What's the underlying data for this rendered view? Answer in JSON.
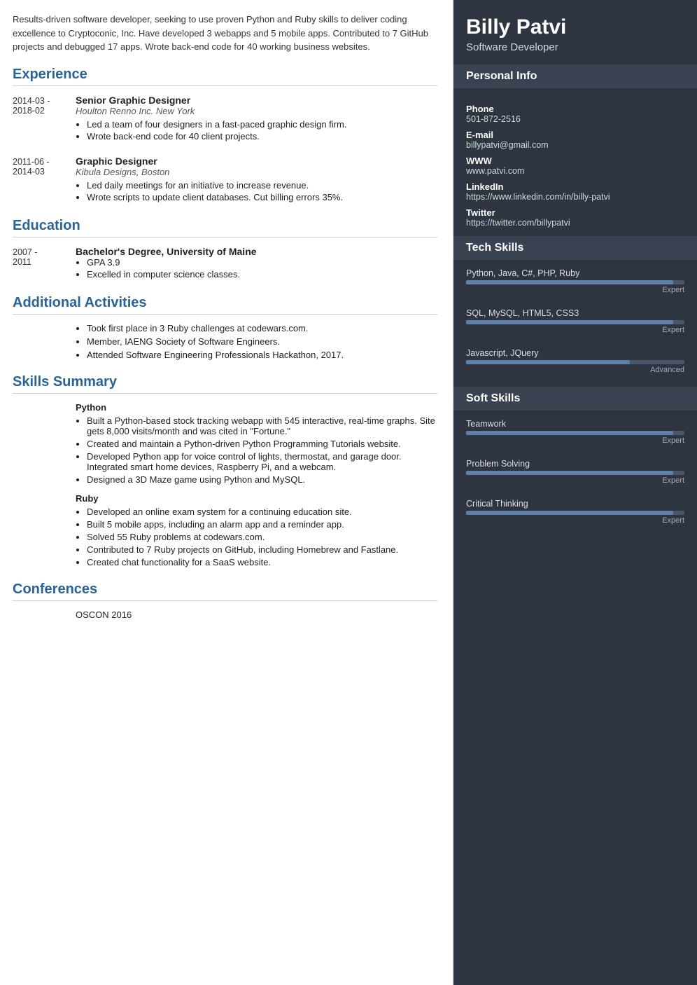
{
  "summary": "Results-driven software developer, seeking to use proven Python and Ruby skills to deliver coding excellence to Cryptoconic, Inc. Have developed 3 webapps and 5 mobile apps. Contributed to 7 GitHub projects and debugged 17 apps. Wrote back-end code for 40 working business websites.",
  "sections": {
    "experience": {
      "title": "Experience",
      "entries": [
        {
          "date_start": "2014-03 -",
          "date_end": "2018-02",
          "job_title": "Senior Graphic Designer",
          "company": "Houlton Renno Inc. New York",
          "bullets": [
            "Led a team of four designers in a fast-paced graphic design firm.",
            "Wrote back-end code for 40 client projects."
          ]
        },
        {
          "date_start": "2011-06 -",
          "date_end": "2014-03",
          "job_title": "Graphic Designer",
          "company": "Kibula Designs, Boston",
          "bullets": [
            "Led daily meetings for an initiative to increase revenue.",
            "Wrote scripts to update client databases. Cut billing errors 35%."
          ]
        }
      ]
    },
    "education": {
      "title": "Education",
      "entries": [
        {
          "date_start": "2007 -",
          "date_end": "2011",
          "degree": "Bachelor's Degree, University of Maine",
          "bullets": [
            "GPA 3.9",
            "Excelled in computer science classes."
          ]
        }
      ]
    },
    "additional_activities": {
      "title": "Additional Activities",
      "bullets": [
        "Took first place in 3 Ruby challenges at codewars.com.",
        "Member, IAENG Society of Software Engineers.",
        "Attended Software Engineering Professionals Hackathon, 2017."
      ]
    },
    "skills_summary": {
      "title": "Skills Summary",
      "subsections": [
        {
          "name": "Python",
          "bullets": [
            "Built a Python-based stock tracking webapp with 545 interactive, real-time graphs. Site gets 8,000 visits/month and was cited in \"Fortune.\"",
            "Created and maintain a Python-driven Python Programming Tutorials website.",
            "Developed Python app for voice control of lights, thermostat, and garage door. Integrated smart home devices, Raspberry Pi, and a webcam.",
            "Designed a 3D Maze game using Python and MySQL."
          ]
        },
        {
          "name": "Ruby",
          "bullets": [
            "Developed an online exam system for a continuing education site.",
            "Built 5 mobile apps, including an alarm app and a reminder app.",
            "Solved 55 Ruby problems at codewars.com.",
            "Contributed to 7 Ruby projects on GitHub, including Homebrew and Fastlane.",
            "Created chat functionality for a SaaS website."
          ]
        }
      ]
    },
    "conferences": {
      "title": "Conferences",
      "items": [
        "OSCON 2016"
      ]
    }
  },
  "right": {
    "name": "Billy Patvi",
    "title": "Software Developer",
    "personal_info": {
      "section_title": "Personal Info",
      "fields": [
        {
          "label": "Phone",
          "value": "501-872-2516"
        },
        {
          "label": "E-mail",
          "value": "billypatvi@gmail.com"
        },
        {
          "label": "WWW",
          "value": "www.patvi.com"
        },
        {
          "label": "LinkedIn",
          "value": "https://www.linkedin.com/in/billy-patvi"
        },
        {
          "label": "Twitter",
          "value": "https://twitter.com/billypatvi"
        }
      ]
    },
    "tech_skills": {
      "section_title": "Tech Skills",
      "skills": [
        {
          "name": "Python, Java, C#, PHP, Ruby",
          "level": "Expert",
          "pct": 95
        },
        {
          "name": "SQL, MySQL, HTML5, CSS3",
          "level": "Expert",
          "pct": 95
        },
        {
          "name": "Javascript, JQuery",
          "level": "Advanced",
          "pct": 75
        }
      ]
    },
    "soft_skills": {
      "section_title": "Soft Skills",
      "skills": [
        {
          "name": "Teamwork",
          "level": "Expert",
          "pct": 95
        },
        {
          "name": "Problem Solving",
          "level": "Expert",
          "pct": 95
        },
        {
          "name": "Critical Thinking",
          "level": "Expert",
          "pct": 95
        }
      ]
    }
  }
}
